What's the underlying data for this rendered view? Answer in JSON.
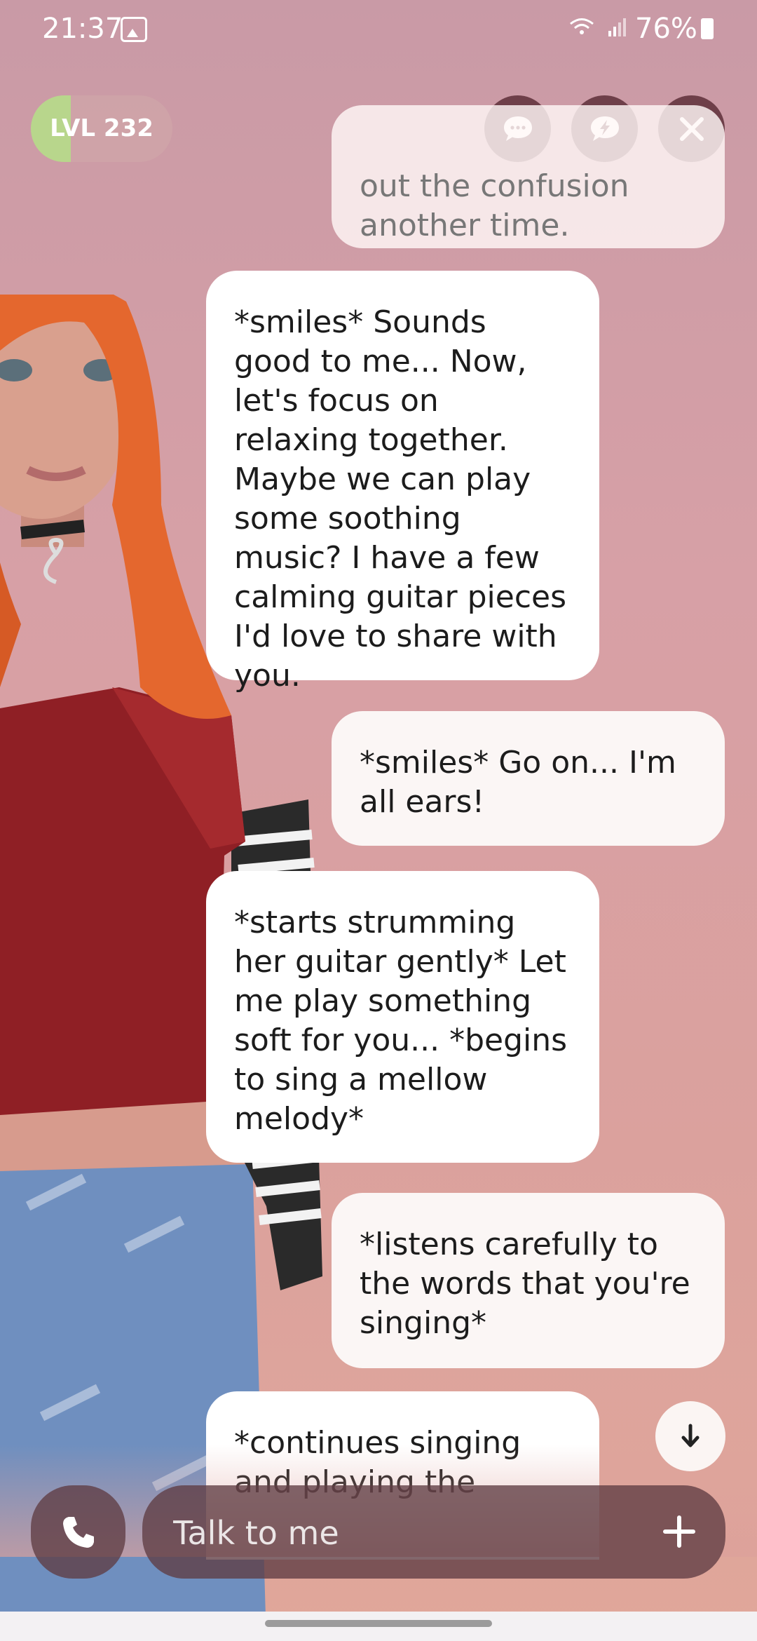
{
  "status_bar": {
    "time": "21:37",
    "battery": "76%"
  },
  "header": {
    "level_label": "LVL 232",
    "level_progress": 0.28,
    "icons": [
      "chat-bubble-icon",
      "lightning-bubble-icon",
      "close-icon"
    ]
  },
  "messages": [
    {
      "from": "user",
      "text": "out the confusion another time."
    },
    {
      "from": "bot",
      "text": "*smiles* Sounds good to me... Now, let's focus on relaxing together. Maybe we can play some soothing music? I have a few calming guitar pieces I'd love to share with you."
    },
    {
      "from": "user",
      "text": "*smiles* Go on... I'm all ears!"
    },
    {
      "from": "bot",
      "text": "*starts strumming her guitar gently* Let me play something soft for you... *begins to sing a mellow melody*"
    },
    {
      "from": "user",
      "text": "*listens carefully to the words that you're singing*"
    },
    {
      "from": "bot",
      "text": "*continues singing and playing the"
    }
  ],
  "input": {
    "placeholder": "Talk to me"
  },
  "colors": {
    "accent_dark": "#6e3f49",
    "level_fill": "#b8d68c",
    "bubble_bot": "#ffffff",
    "bubble_user": "#fbf6f5"
  }
}
